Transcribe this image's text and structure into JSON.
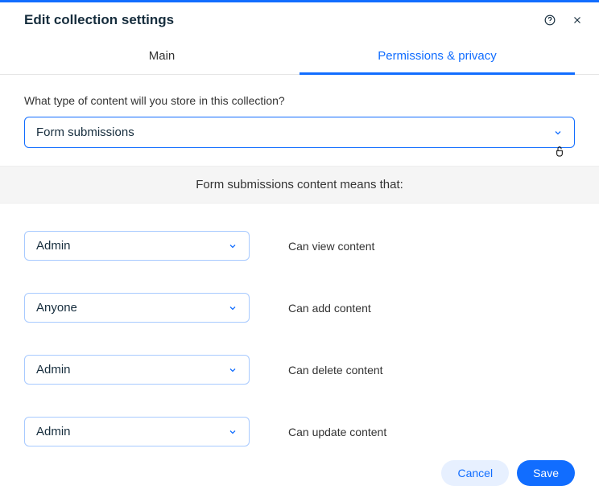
{
  "header": {
    "title": "Edit collection settings"
  },
  "tabs": {
    "main": "Main",
    "permissions": "Permissions & privacy"
  },
  "contentTypeQuestion": "What type of content will you store in this collection?",
  "contentTypeValue": "Form submissions",
  "infoBand": "Form submissions content means that:",
  "permissions": [
    {
      "role": "Admin",
      "desc": "Can view content"
    },
    {
      "role": "Anyone",
      "desc": "Can add content"
    },
    {
      "role": "Admin",
      "desc": "Can delete content"
    },
    {
      "role": "Admin",
      "desc": "Can update content"
    }
  ],
  "buttons": {
    "cancel": "Cancel",
    "save": "Save"
  }
}
